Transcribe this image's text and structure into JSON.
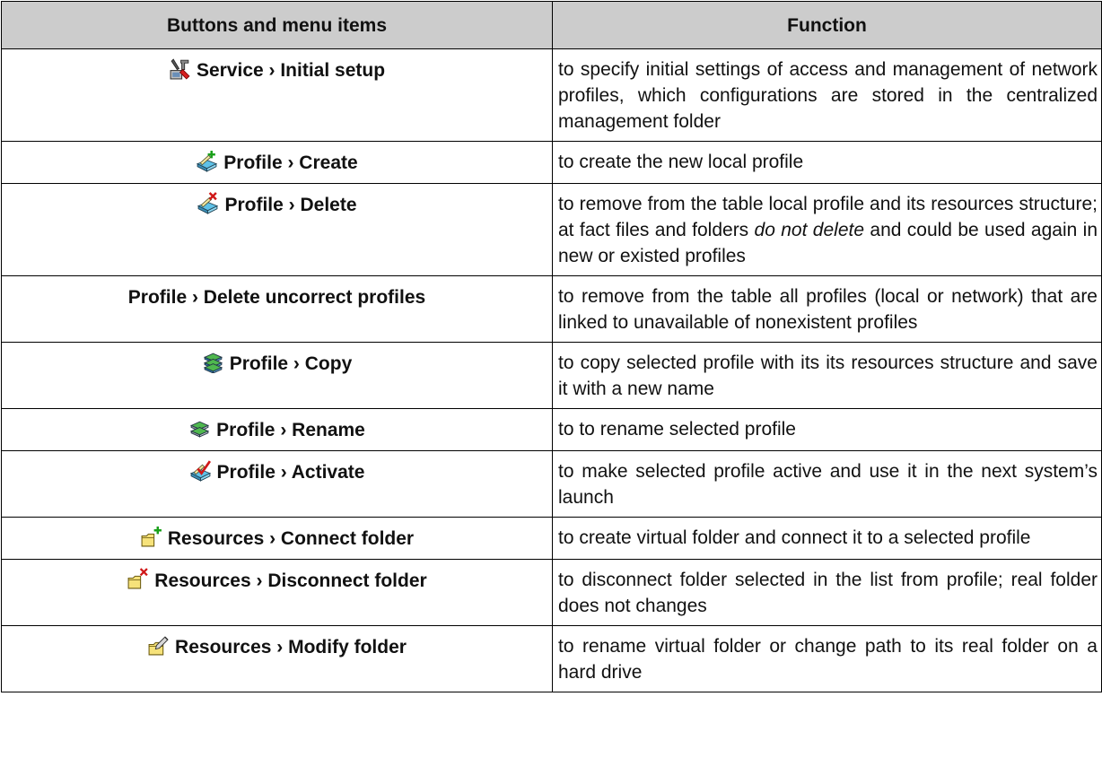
{
  "table": {
    "header": {
      "col1": "Buttons and menu items",
      "col2": "Function"
    },
    "rows": [
      {
        "icon": "setup-tools-icon",
        "command": "Service › Initial setup",
        "description": "to specify initial settings of access and management of network profiles, which configurations are stored in the centralized management folder"
      },
      {
        "icon": "profile-create-icon",
        "command": "Profile › Create",
        "description": "to create the new local profile"
      },
      {
        "icon": "profile-delete-icon",
        "command": "Profile › Delete",
        "description_before": "to remove from the table local profile and its resources structure; at fact files and folders ",
        "description_em": "do not delete",
        "description_after": " and could be used again in new or existed profiles"
      },
      {
        "icon": "",
        "command": "Profile › Delete uncorrect profiles",
        "description": "to remove from the table all profiles (local or network) that are linked to unavailable of nonexistent profiles"
      },
      {
        "icon": "profile-copy-icon",
        "command": "Profile › Copy",
        "description": "to copy selected profile with its its resources structure and save it with a new name"
      },
      {
        "icon": "profile-rename-icon",
        "command": "Profile › Rename",
        "description": "to to rename selected profile"
      },
      {
        "icon": "profile-activate-icon",
        "command": "Profile › Activate",
        "description": "to make selected profile active and use it in the next system’s launch"
      },
      {
        "icon": "folder-connect-icon",
        "command": "Resources › Connect folder",
        "description": "to create virtual folder and connect it to a selected profile"
      },
      {
        "icon": "folder-disconnect-icon",
        "command": "Resources › Disconnect folder",
        "description": "to disconnect folder selected in the list from profile; real folder does not changes"
      },
      {
        "icon": "folder-modify-icon",
        "command": "Resources › Modify folder",
        "description": "to rename virtual folder or change path to its real folder on a hard drive"
      }
    ]
  }
}
